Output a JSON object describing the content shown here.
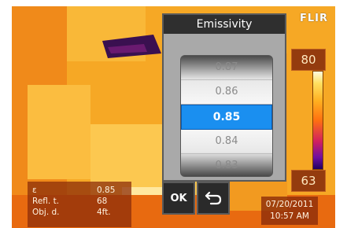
{
  "brand": "FLIR",
  "scale": {
    "max": "80",
    "min": "63"
  },
  "dialog": {
    "title": "Emissivity",
    "options": [
      "0.87",
      "0.86",
      "0.85",
      "0.84",
      "0.83"
    ],
    "selected": "0.85"
  },
  "buttons": {
    "ok": "OK",
    "back_icon": "return-arrow-icon"
  },
  "params": [
    {
      "label": "ε",
      "value": "0.85"
    },
    {
      "label": "Refl. t.",
      "value": "68"
    },
    {
      "label": "Obj. d.",
      "value": "4ft."
    }
  ],
  "datetime": {
    "date": "07/20/2011",
    "time": "10:57 AM"
  },
  "colors": {
    "selection": "#1a8ff0",
    "dialog_bg": "#a9a9a9",
    "overlay_bg": "#8c2d0a"
  }
}
